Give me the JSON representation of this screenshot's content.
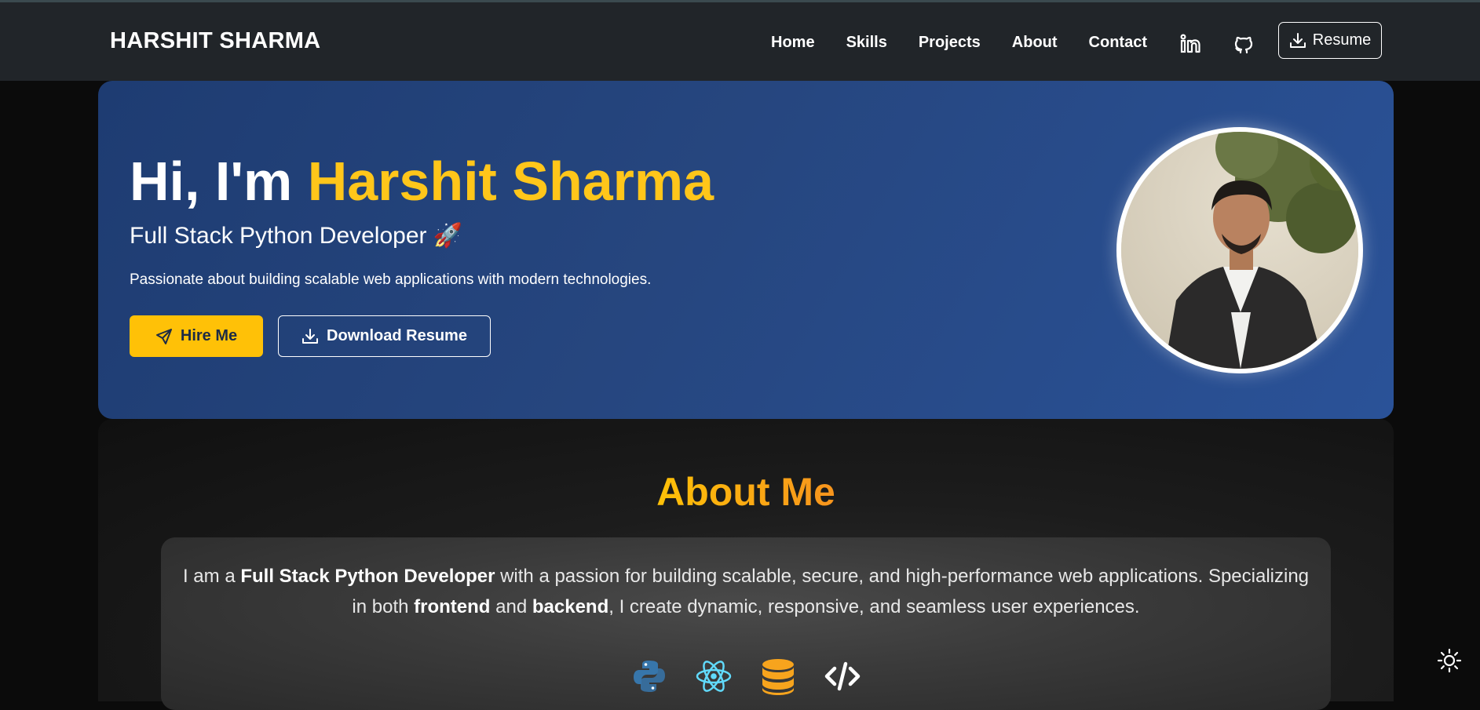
{
  "navbar": {
    "brand": "HARSHIT SHARMA",
    "links": [
      "Home",
      "Skills",
      "Projects",
      "About",
      "Contact"
    ],
    "icons": [
      "linkedin-icon",
      "github-icon"
    ],
    "resume_label": "Resume"
  },
  "hero": {
    "greeting": "Hi, I'm ",
    "name": "Harshit Sharma",
    "subtitle": "Full Stack Python Developer 🚀",
    "description": "Passionate about building scalable web applications with modern technologies.",
    "hire_label": "Hire Me",
    "download_label": "Download Resume"
  },
  "about": {
    "title": "About Me",
    "text_parts": {
      "p1": "I am a ",
      "b1": "Full Stack Python Developer",
      "p2": " with a passion for building scalable, secure, and high-performance web applications. Specializing in both ",
      "b2": "frontend",
      "p3": " and ",
      "b3": "backend",
      "p4": ", I create dynamic, responsive, and seamless user experiences."
    },
    "tech_icons": [
      "python-icon",
      "react-icon",
      "database-icon",
      "code-icon"
    ]
  },
  "colors": {
    "accent": "#ffc61a",
    "hero_start": "#1e3c72",
    "hero_end": "#2a5298",
    "navbar": "#212529"
  }
}
